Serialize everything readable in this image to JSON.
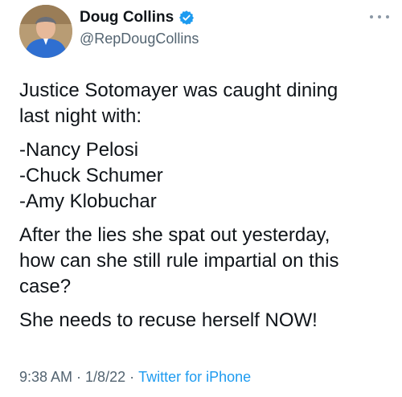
{
  "author": {
    "display_name": "Doug Collins",
    "handle": "@RepDougCollins",
    "verified": true
  },
  "tweet": {
    "line1": "Justice Sotomayer was caught dining",
    "line2": "last night with:",
    "list": [
      "-Nancy Pelosi",
      "-Chuck Schumer",
      "-Amy Klobuchar"
    ],
    "para2_line1": "After the lies she spat out yesterday,",
    "para2_line2": "how can she still rule impartial on this",
    "para2_line3": "case?",
    "para3": "She needs to recuse herself NOW!"
  },
  "meta": {
    "time": "9:38 AM",
    "separator": "·",
    "date": "1/8/22",
    "source": "Twitter for iPhone"
  },
  "icons": {
    "verified": "verified-badge-icon",
    "more": "more-options-icon"
  },
  "colors": {
    "text": "#0f1419",
    "secondary": "#536471",
    "accent": "#1d9bf0"
  }
}
